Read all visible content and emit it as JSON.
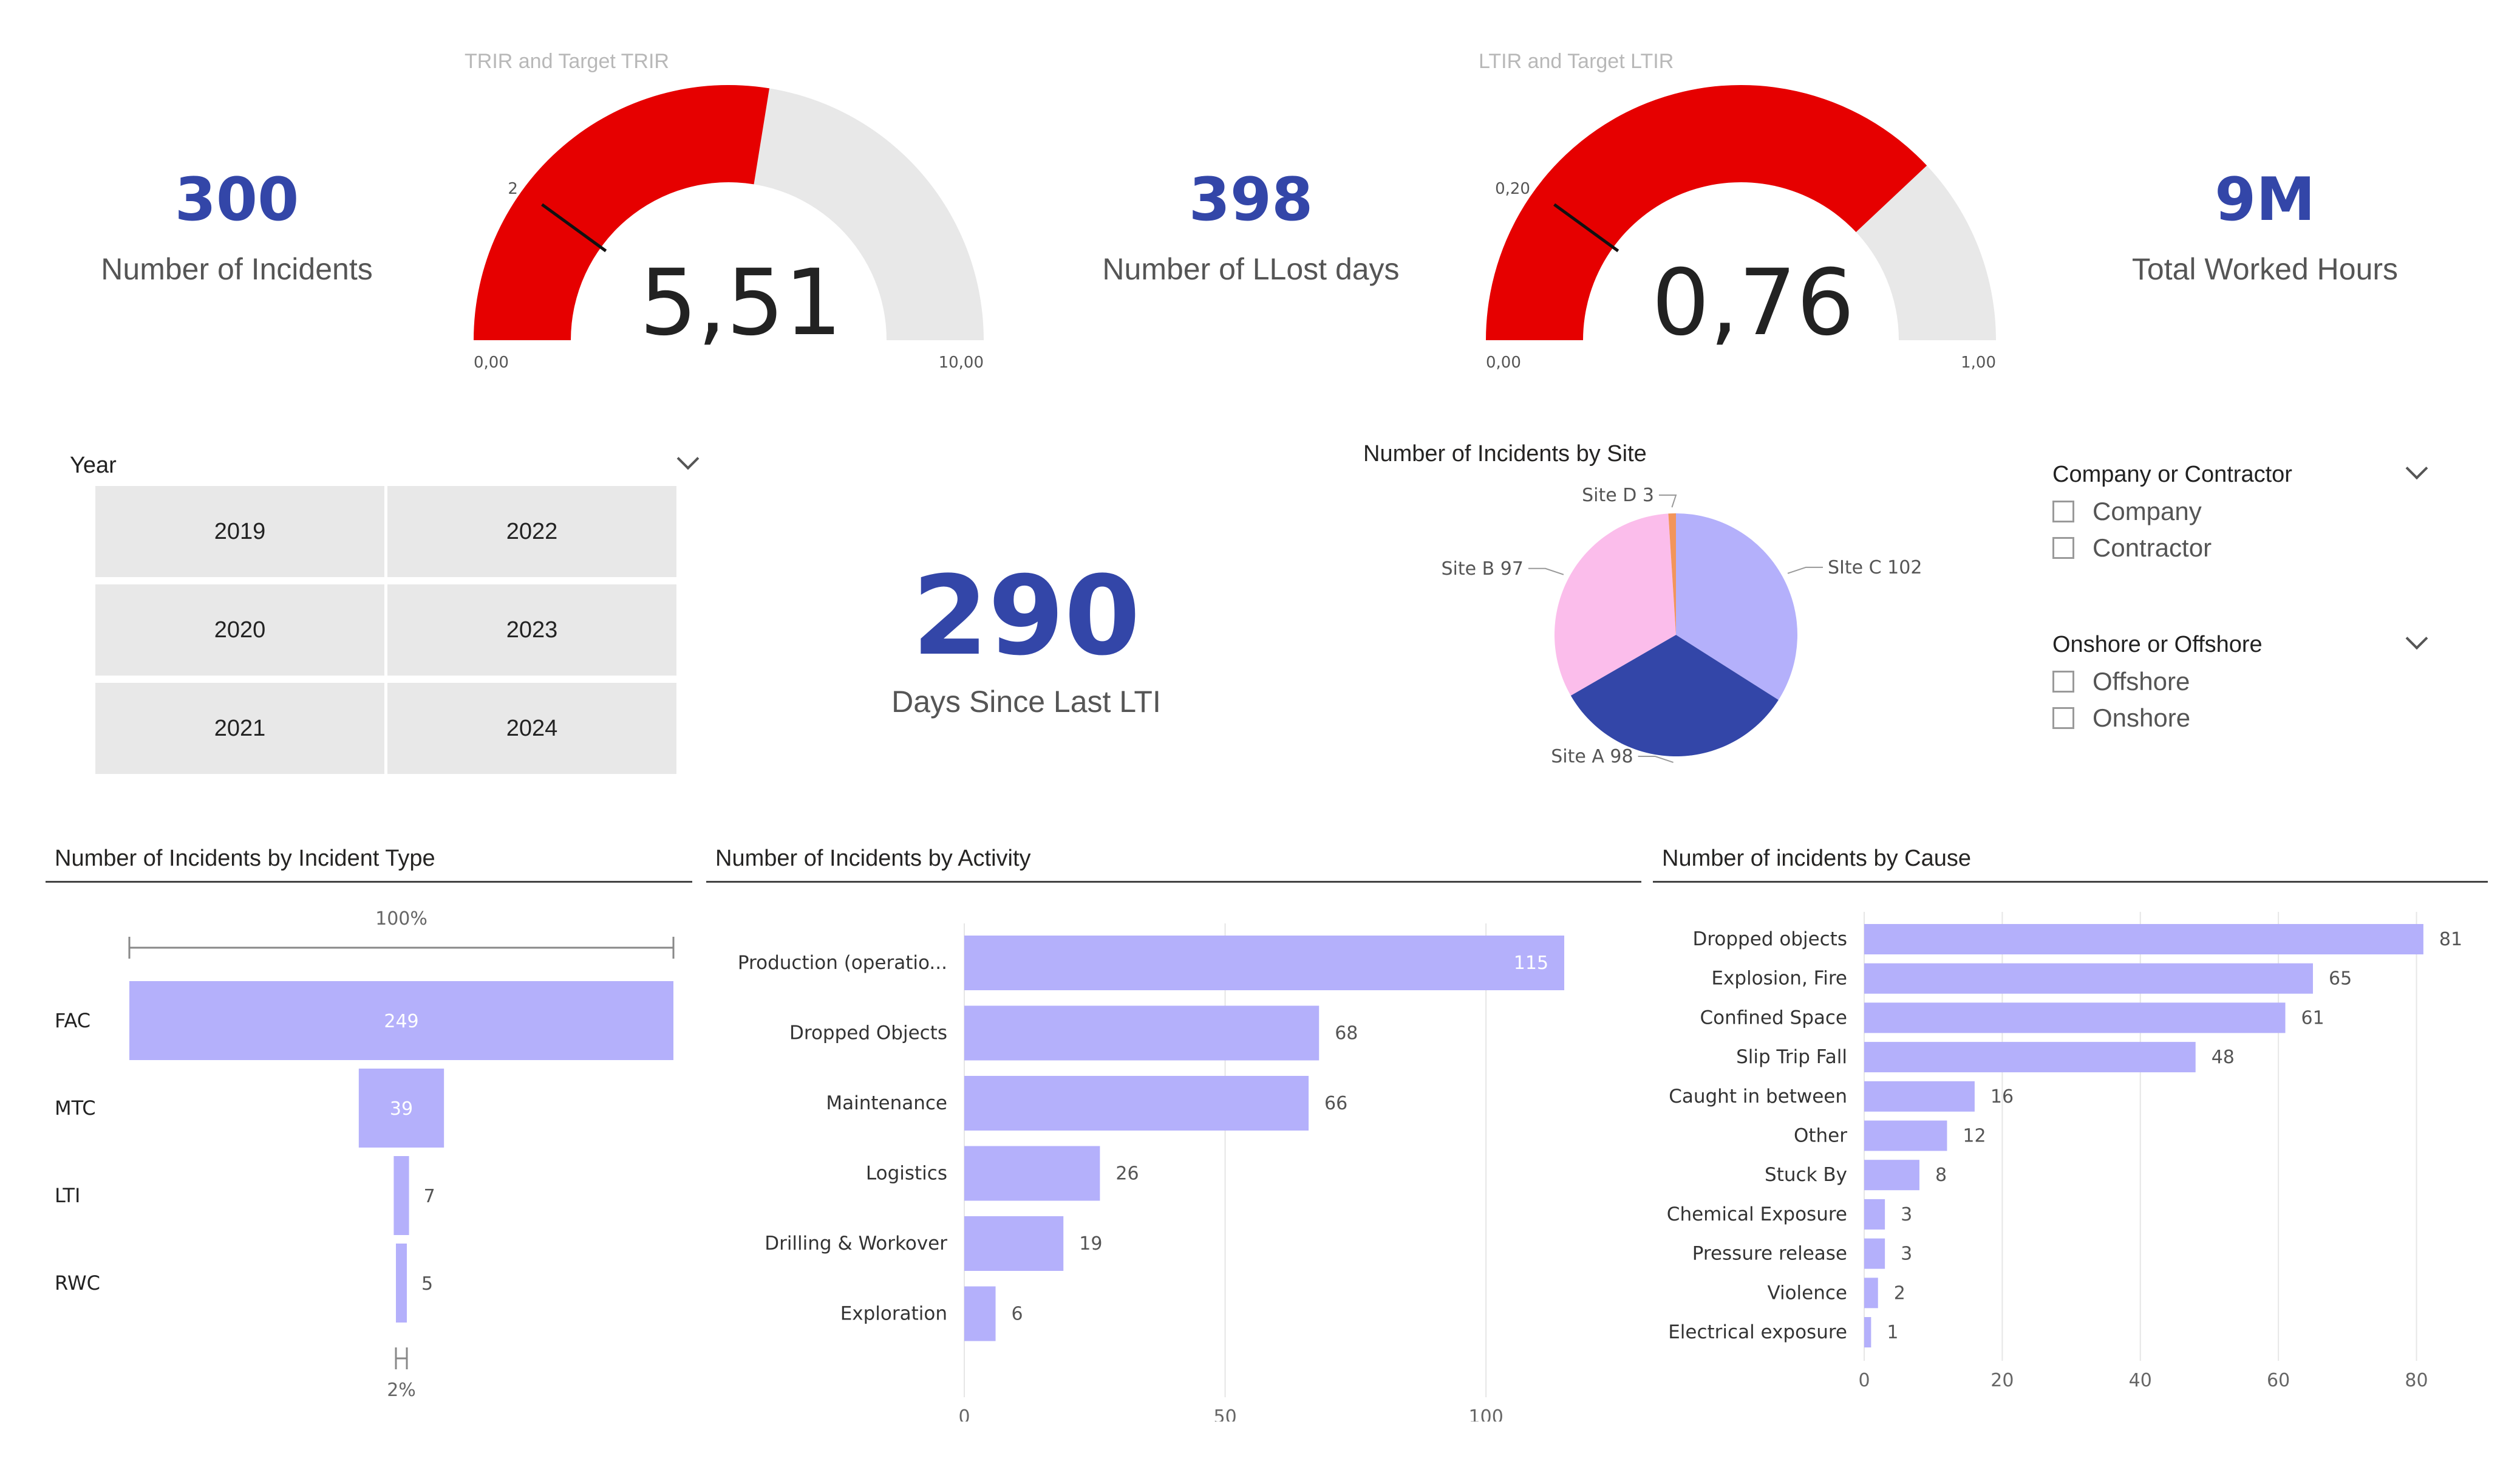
{
  "kpis": {
    "incidents": {
      "value": "300",
      "label": "Number of Incidents"
    },
    "lost_days": {
      "value": "398",
      "label": "Number of LLost days"
    },
    "worked_hours": {
      "value": "9M",
      "label": "Total Worked Hours"
    },
    "days_since_lti": {
      "value": "290",
      "label": "Days Since Last LTI"
    }
  },
  "year_slicer": {
    "title": "Year",
    "options": [
      "2019",
      "2022",
      "2020",
      "2023",
      "2021",
      "2024"
    ]
  },
  "company_slicer": {
    "title": "Company or Contractor",
    "options": [
      "Company",
      "Contractor"
    ]
  },
  "location_slicer": {
    "title": "Onshore or Offshore",
    "options": [
      "Offshore",
      "Onshore"
    ]
  },
  "colors": {
    "accent": "#3346a8",
    "gauge_fill": "#e60000",
    "gauge_track": "#e8e8e8",
    "bar": "#b4b0fb",
    "pie_site_c": "#b4b0fb",
    "pie_site_a": "#3346a8",
    "pie_site_b": "#fbbdeb",
    "pie_site_d": "#f2955a"
  },
  "chart_data": [
    {
      "type": "gauge",
      "title": "TRIR and Target TRIR",
      "value": 5.51,
      "value_label": "5,51",
      "target": 2,
      "target_label": "2",
      "min": 0,
      "max": 10,
      "min_label": "0,00",
      "max_label": "10,00"
    },
    {
      "type": "gauge",
      "title": "LTIR and Target LTIR",
      "value": 0.76,
      "value_label": "0,76",
      "target": 0.2,
      "target_label": "0,20",
      "min": 0,
      "max": 1,
      "min_label": "0,00",
      "max_label": "1,00"
    },
    {
      "type": "pie",
      "title": "Number of Incidents by Site",
      "categories": [
        "SIte C",
        "Site A",
        "Site B",
        "Site D"
      ],
      "values": [
        102,
        98,
        97,
        3
      ]
    },
    {
      "type": "funnel",
      "title": "Number of Incidents by Incident Type",
      "categories": [
        "FAC",
        "MTC",
        "LTI",
        "RWC"
      ],
      "values": [
        249,
        39,
        7,
        5
      ],
      "top_label": "100%",
      "bottom_label": "2%"
    },
    {
      "type": "bar",
      "title": "Number of Incidents by Activity",
      "categories": [
        "Production (operatio...",
        "Dropped Objects",
        "Maintenance",
        "Logistics",
        "Drilling & Workover",
        "Exploration"
      ],
      "values": [
        115,
        68,
        66,
        26,
        19,
        6
      ],
      "xlim": [
        0,
        120
      ],
      "ticks": [
        0,
        50,
        100
      ]
    },
    {
      "type": "bar",
      "title": "Number of incidents by Cause",
      "categories": [
        "Dropped objects",
        "Explosion, Fire",
        "Confined Space",
        "Slip Trip Fall",
        "Caught in between",
        "Other",
        "Stuck By",
        "Chemical Exposure",
        "Pressure release",
        "Violence",
        "Electrical exposure"
      ],
      "values": [
        81,
        65,
        61,
        48,
        16,
        12,
        8,
        3,
        3,
        2,
        1
      ],
      "xlim": [
        0,
        84
      ],
      "ticks": [
        0,
        20,
        40,
        60,
        80
      ]
    }
  ]
}
